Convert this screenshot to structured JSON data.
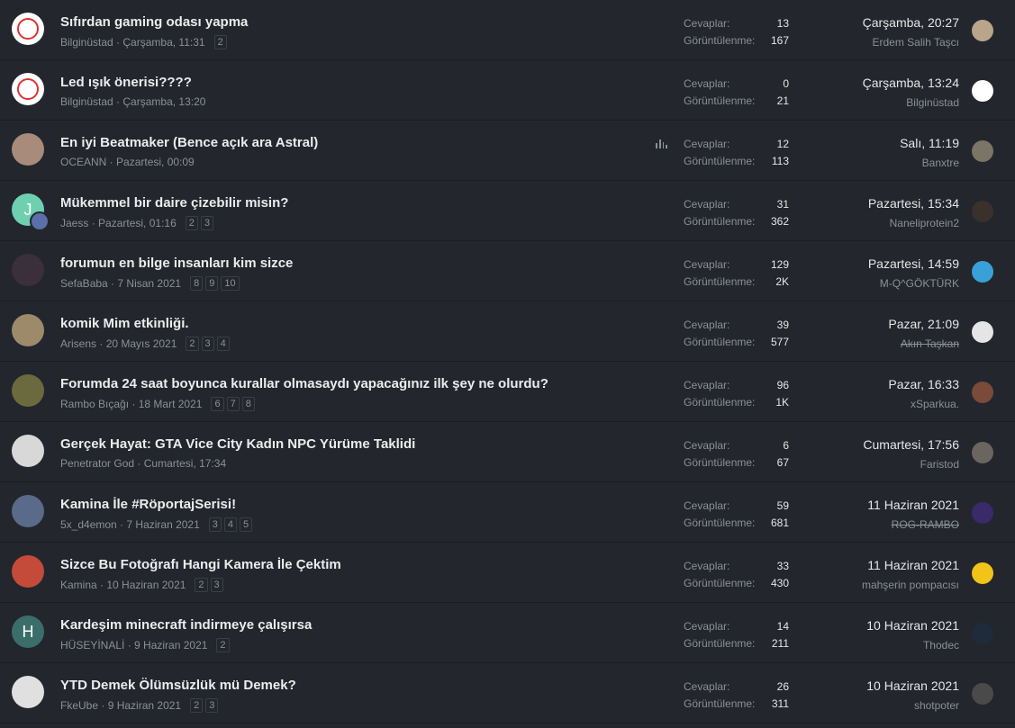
{
  "labels": {
    "replies": "Cevaplar:",
    "views": "Görüntülenme:"
  },
  "threads": [
    {
      "title": "Sıfırdan gaming odası yapma",
      "author": "Bilginüstad",
      "date": "Çarşamba, 11:31",
      "pages": [
        "2"
      ],
      "replies": "13",
      "views": "167",
      "last_date": "Çarşamba, 20:27",
      "last_user": "Erdem Salih Taşcı",
      "avatar_color": "#ffffff",
      "avatar_letter": "",
      "avatar_kind": "amd",
      "last_avatar_color": "#b9a58a"
    },
    {
      "title": "Led ışık önerisi????",
      "author": "Bilginüstad",
      "date": "Çarşamba, 13:20",
      "pages": [],
      "replies": "0",
      "views": "21",
      "last_date": "Çarşamba, 13:24",
      "last_user": "Bilginüstad",
      "avatar_color": "#ffffff",
      "avatar_letter": "",
      "avatar_kind": "amd",
      "last_avatar_color": "#ffffff"
    },
    {
      "title": "En iyi Beatmaker (Bence açık ara Astral)",
      "author": "OCEANN",
      "date": "Pazartesi, 00:09",
      "pages": [],
      "replies": "12",
      "views": "113",
      "last_date": "Salı, 11:19",
      "last_user": "Banxtre",
      "avatar_color": "#a88b7a",
      "avatar_letter": "",
      "avatar_kind": "photo",
      "last_avatar_color": "#7b7467",
      "poll": true
    },
    {
      "title": "Mükemmel bir daire çizebilir misin?",
      "author": "Jaess",
      "date": "Pazartesi, 01:16",
      "pages": [
        "2",
        "3"
      ],
      "replies": "31",
      "views": "362",
      "last_date": "Pazartesi, 15:34",
      "last_user": "Naneliprotein2",
      "avatar_color": "#6fd0b0",
      "avatar_letter": "J",
      "avatar_kind": "letter",
      "last_avatar_color": "#3a302c",
      "sub_avatar": true
    },
    {
      "title": "forumun en bilge insanları kim sizce",
      "author": "SefaBaba",
      "date": "7 Nisan 2021",
      "pages": [
        "8",
        "9",
        "10"
      ],
      "replies": "129",
      "views": "2K",
      "last_date": "Pazartesi, 14:59",
      "last_user": "M-Q^GÖKTÜRK",
      "avatar_color": "#3b2f3a",
      "avatar_letter": "",
      "avatar_kind": "photo",
      "last_avatar_color": "#3aa0d8"
    },
    {
      "title": "komik Mim etkinliği.",
      "author": "Arisens",
      "date": "20 Mayıs 2021",
      "pages": [
        "2",
        "3",
        "4"
      ],
      "replies": "39",
      "views": "577",
      "last_date": "Pazar, 21:09",
      "last_user": "Akın Taşkan",
      "last_user_strike": true,
      "avatar_color": "#9d8a6a",
      "avatar_letter": "",
      "avatar_kind": "photo",
      "last_avatar_color": "#e5e5e5"
    },
    {
      "title": "Forumda 24 saat boyunca kurallar olmasaydı yapacağınız ilk şey ne olurdu?",
      "author": "Rambo Bıçağı",
      "date": "18 Mart 2021",
      "pages": [
        "6",
        "7",
        "8"
      ],
      "replies": "96",
      "views": "1K",
      "last_date": "Pazar, 16:33",
      "last_user": "xSparkua.",
      "avatar_color": "#6b6a3e",
      "avatar_letter": "",
      "avatar_kind": "photo",
      "last_avatar_color": "#7a4a3a"
    },
    {
      "title": "Gerçek Hayat: GTA Vice City Kadın NPC Yürüme Taklidi",
      "author": "Penetrator God",
      "date": "Cumartesi, 17:34",
      "pages": [],
      "replies": "6",
      "views": "67",
      "last_date": "Cumartesi, 17:56",
      "last_user": "Faristod",
      "avatar_color": "#d8d8d8",
      "avatar_letter": "",
      "avatar_kind": "photo",
      "last_avatar_color": "#6b6560"
    },
    {
      "title": "Kamina İle #RöportajSerisi!",
      "author": "5x_d4emon",
      "date": "7 Haziran 2021",
      "pages": [
        "3",
        "4",
        "5"
      ],
      "replies": "59",
      "views": "681",
      "last_date": "11 Haziran 2021",
      "last_user": "ROG-RAMBO",
      "last_user_strike": true,
      "avatar_color": "#5a6a8a",
      "avatar_letter": "",
      "avatar_kind": "photo",
      "last_avatar_color": "#3a2a6a"
    },
    {
      "title": "Sizce Bu Fotoğrafı Hangi Kamera İle Çektim",
      "author": "Kamina",
      "date": "10 Haziran 2021",
      "pages": [
        "2",
        "3"
      ],
      "replies": "33",
      "views": "430",
      "last_date": "11 Haziran 2021",
      "last_user": "mahşerin pompacısı",
      "avatar_color": "#c44a3a",
      "avatar_letter": "",
      "avatar_kind": "photo",
      "last_avatar_color": "#f2c318"
    },
    {
      "title": "Kardeşim minecraft indirmeye çalışırsa",
      "author": "HÜSEYİNALİ",
      "date": "9 Haziran 2021",
      "pages": [
        "2"
      ],
      "replies": "14",
      "views": "211",
      "last_date": "10 Haziran 2021",
      "last_user": "Thodec",
      "avatar_color": "#3b6e6a",
      "avatar_letter": "H",
      "avatar_kind": "letter",
      "last_avatar_color": "#1f2b3a"
    },
    {
      "title": "YTD Demek Ölümsüzlük mü Demek?",
      "author": "FkeUbe",
      "date": "9 Haziran 2021",
      "pages": [
        "2",
        "3"
      ],
      "replies": "26",
      "views": "311",
      "last_date": "10 Haziran 2021",
      "last_user": "shotpoter",
      "avatar_color": "#e0e0e0",
      "avatar_letter": "",
      "avatar_kind": "photo",
      "last_avatar_color": "#4a4a4a"
    }
  ]
}
